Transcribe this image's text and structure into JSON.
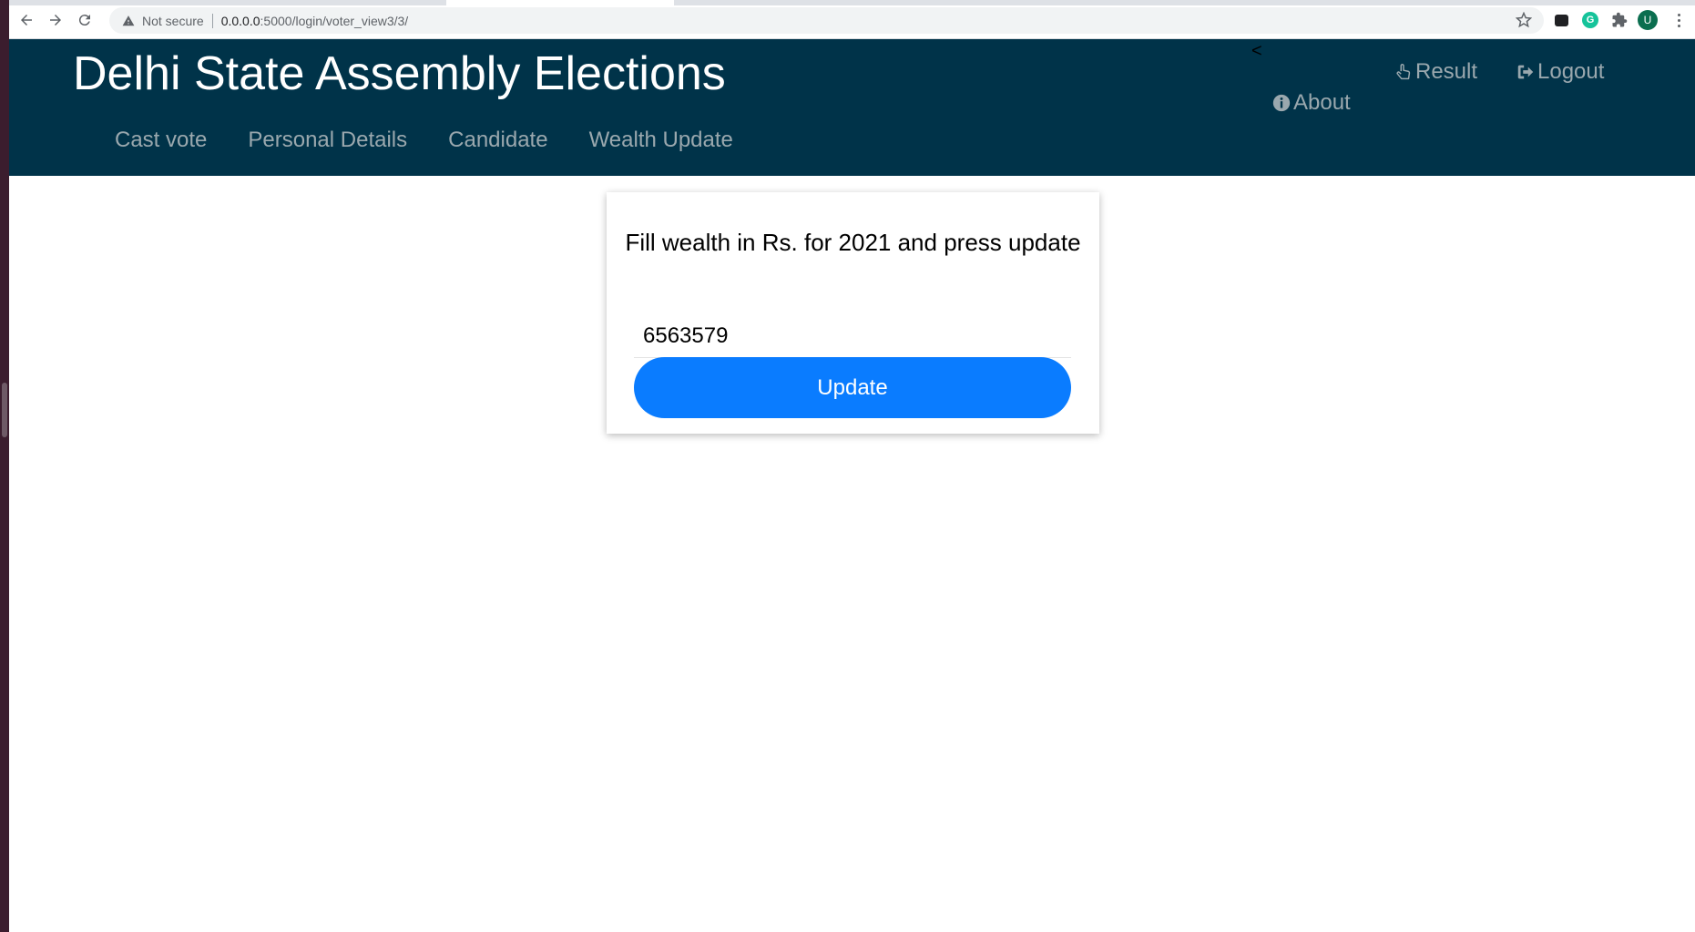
{
  "browser": {
    "security_label": "Not secure",
    "url_host": "0.0.0.0",
    "url_path": ":5000/login/voter_view3/3/",
    "profile_initial": "U",
    "grammarly_letter": "G"
  },
  "header": {
    "title": "Delhi State Assembly Elections",
    "stray_char": "<",
    "nav": [
      "Cast vote",
      "Personal Details",
      "Candidate",
      "Wealth Update"
    ],
    "result_label": "Result",
    "logout_label": "Logout",
    "about_label": "About"
  },
  "form": {
    "heading": "Fill wealth in Rs. for 2021 and press update",
    "wealth_value": "6563579",
    "button_label": "Update"
  },
  "colors": {
    "header_bg": "#003349",
    "button_bg": "#0a7cff",
    "nav_text": "#9aa8ae"
  },
  "icons": [
    "back-arrow-icon",
    "forward-arrow-icon",
    "reload-icon",
    "warning-icon",
    "star-icon",
    "puzzle-icon",
    "hand-pointer-icon",
    "sign-out-icon",
    "info-circle-icon"
  ]
}
